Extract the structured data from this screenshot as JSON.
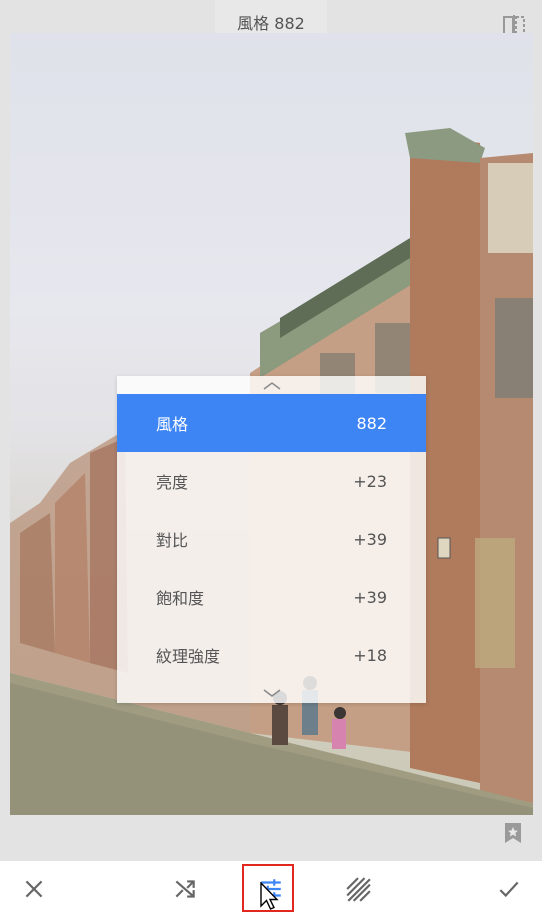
{
  "header": {
    "title": "風格 882"
  },
  "adjustments": {
    "items": [
      {
        "label": "風格",
        "value": "882",
        "active": true
      },
      {
        "label": "亮度",
        "value": "+23",
        "active": false
      },
      {
        "label": "對比",
        "value": "+39",
        "active": false
      },
      {
        "label": "飽和度",
        "value": "+39",
        "active": false
      },
      {
        "label": "紋理強度",
        "value": "+18",
        "active": false
      }
    ]
  },
  "toolbar": {
    "icons": [
      "close-icon",
      "shuffle-icon",
      "sliders-icon",
      "diagonal-lines-icon",
      "check-icon"
    ],
    "selected": "sliders-icon"
  },
  "colors": {
    "accent": "#3d84f5",
    "highlight_box": "#e0281f"
  }
}
